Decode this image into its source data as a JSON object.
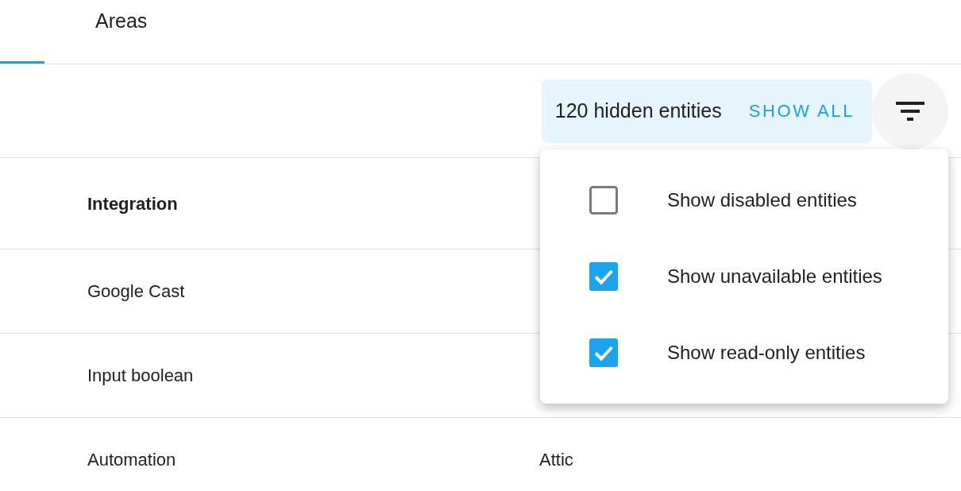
{
  "tabs": [
    {
      "selected": true
    },
    {
      "label": "Areas",
      "selected": false
    }
  ],
  "hidden_banner": {
    "text": "120 hidden entities",
    "button": "SHOW ALL"
  },
  "filter_menu": {
    "items": [
      {
        "label": "Show disabled entities",
        "checked": false
      },
      {
        "label": "Show unavailable entities",
        "checked": true
      },
      {
        "label": "Show read-only entities",
        "checked": true
      }
    ]
  },
  "table": {
    "columns": [
      "Integration"
    ],
    "rows": [
      {
        "cells": [
          "Google Cast"
        ]
      },
      {
        "cells": [
          "Input boolean"
        ]
      },
      {
        "cells": [
          "Automation",
          "Attic"
        ]
      }
    ]
  }
}
